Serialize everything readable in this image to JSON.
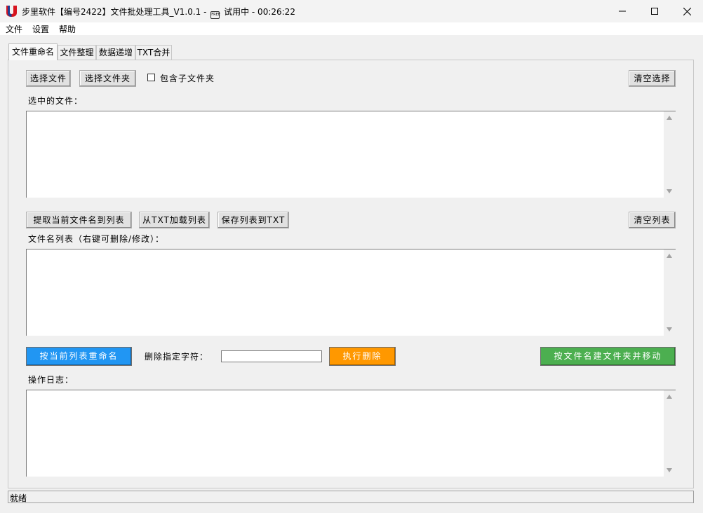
{
  "window": {
    "title_prefix": "步里软件【编号2422】文件批处理工具_V1.0.1 -",
    "badge": "FREE",
    "title_suffix": "试用中 - 00:26:22"
  },
  "menu": [
    "文件",
    "设置",
    "帮助"
  ],
  "tabs": [
    {
      "label": "文件重命名",
      "active": true
    },
    {
      "label": "文件整理",
      "active": false
    },
    {
      "label": "数据递增",
      "active": false
    },
    {
      "label": "TXT合并",
      "active": false
    }
  ],
  "files_section": {
    "select_file_button": "选择文件",
    "select_folder_button": "选择文件夹",
    "include_subfolders_label": "包含子文件夹",
    "include_subfolders_checked": false,
    "clear_selection_button": "清空选择",
    "selected_files_label": "选中的文件："
  },
  "names_section": {
    "extract_button": "提取当前文件名到列表",
    "load_txt_button": "从TXT加载列表",
    "save_txt_button": "保存列表到TXT",
    "clear_list_button": "清空列表",
    "list_label": "文件名列表（右键可删除/修改）："
  },
  "actions": {
    "rename_button": "按当前列表重命名",
    "delete_chars_label": "删除指定字符：",
    "delete_chars_value": "",
    "execute_delete_button": "执行删除",
    "create_folder_move_button": "按文件名建文件夹并移动"
  },
  "log": {
    "label": "操作日志："
  },
  "status": {
    "text": "就绪"
  },
  "colors": {
    "rename_button": "#2196f3",
    "execute_delete_button": "#ff9800",
    "create_folder_move_button": "#4caf50"
  }
}
